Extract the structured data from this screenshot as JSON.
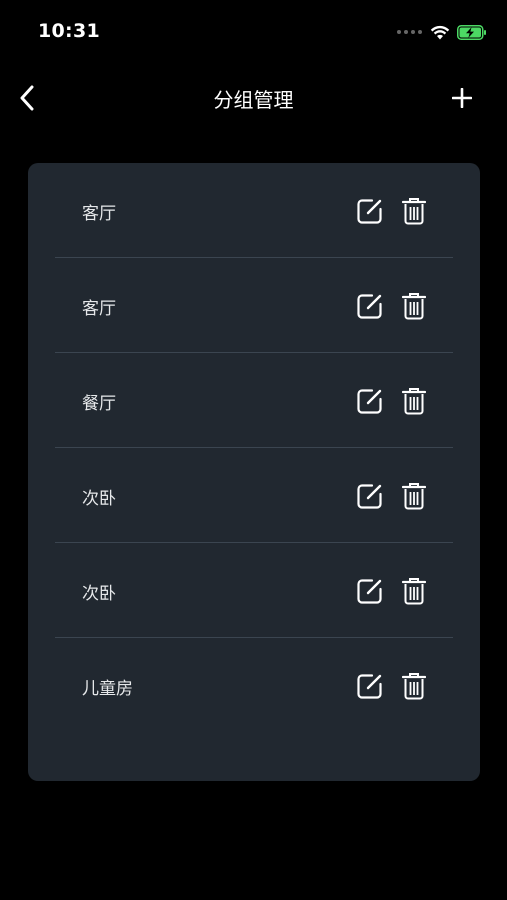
{
  "status_bar": {
    "time": "10:31"
  },
  "nav": {
    "title": "分组管理",
    "back_icon": "chevron-left-icon",
    "add_icon": "plus-icon"
  },
  "groups": [
    {
      "name": "客厅"
    },
    {
      "name": "客厅"
    },
    {
      "name": "餐厅"
    },
    {
      "name": "次卧"
    },
    {
      "name": "次卧"
    },
    {
      "name": "儿童房"
    }
  ],
  "row_actions": {
    "edit_icon": "edit-icon",
    "delete_icon": "trash-icon"
  },
  "colors": {
    "background": "#000000",
    "card": "#212830",
    "divider": "#3b4550",
    "text": "#ffffff",
    "battery": "#4cd964"
  }
}
